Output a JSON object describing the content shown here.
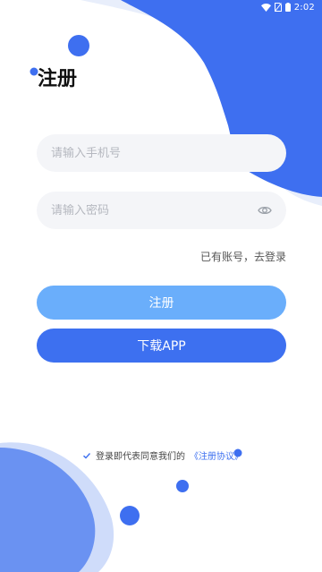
{
  "status_bar": {
    "time": "2:02",
    "icons": [
      "wifi-icon",
      "no-sim-icon",
      "battery-icon"
    ]
  },
  "page": {
    "title": "注册"
  },
  "form": {
    "phone_placeholder": "请输入手机号",
    "phone_value": "",
    "password_placeholder": "请输入密码",
    "password_value": "",
    "password_toggle_icon": "eye-icon"
  },
  "links": {
    "have_account": "已有账号，去登录"
  },
  "buttons": {
    "register": "注册",
    "download": "下载APP"
  },
  "agreement": {
    "text": "登录即代表同意我们的",
    "link": "《注册协议》",
    "checked": true
  },
  "colors": {
    "accent_dark": "#3d70f0",
    "accent_light": "#6aaefb",
    "field_bg": "#f4f5f8"
  }
}
